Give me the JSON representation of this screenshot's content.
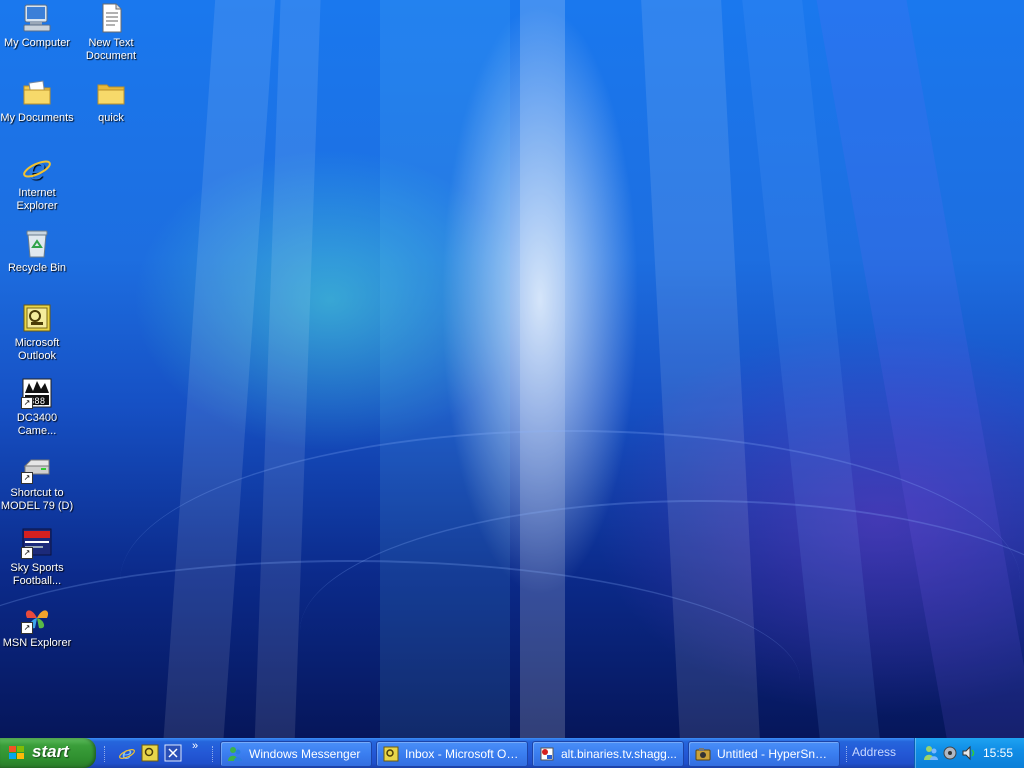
{
  "desktop": {
    "icons": [
      {
        "label": "My Computer",
        "icon": "my-computer-icon"
      },
      {
        "label": "New Text Document",
        "icon": "text-document-icon"
      },
      {
        "label": "My Documents",
        "icon": "my-documents-folder-icon"
      },
      {
        "label": "quick",
        "icon": "folder-icon"
      },
      {
        "label": "Internet Explorer",
        "icon": "internet-explorer-icon"
      },
      {
        "label": "Recycle Bin",
        "icon": "recycle-bin-icon"
      },
      {
        "label": "Microsoft Outlook",
        "icon": "outlook-icon"
      },
      {
        "label": "DC3400 Came...",
        "icon": "camera-app-icon"
      },
      {
        "label": "Shortcut to MODEL 79 (D)",
        "icon": "drive-shortcut-icon"
      },
      {
        "label": "Sky Sports Football...",
        "icon": "sky-sports-icon"
      },
      {
        "label": "MSN Explorer",
        "icon": "msn-butterfly-icon"
      }
    ]
  },
  "taskbar": {
    "start_label": "start",
    "quick_launch": [
      {
        "icon": "internet-explorer-icon"
      },
      {
        "icon": "outlook-icon"
      },
      {
        "icon": "show-desktop-icon"
      }
    ],
    "overflow_chevron": "»",
    "tasks": [
      {
        "label": "Windows Messenger",
        "icon": "messenger-icon"
      },
      {
        "label": "Inbox - Microsoft Ou...",
        "icon": "outlook-icon"
      },
      {
        "label": "alt.binaries.tv.shagg...",
        "icon": "newsreader-icon"
      },
      {
        "label": "Untitled - HyperSnap...",
        "icon": "hypersnap-icon"
      }
    ],
    "address_label": "Address",
    "tray": {
      "icons": [
        "messenger-tray-icon",
        "network-tray-icon",
        "volume-tray-icon"
      ],
      "clock": "15:55"
    }
  },
  "colors": {
    "taskbar": "#2458d6",
    "start_green": "#3a9e3a",
    "tray": "#108de6",
    "wallpaper_top": "#1a78ee"
  }
}
